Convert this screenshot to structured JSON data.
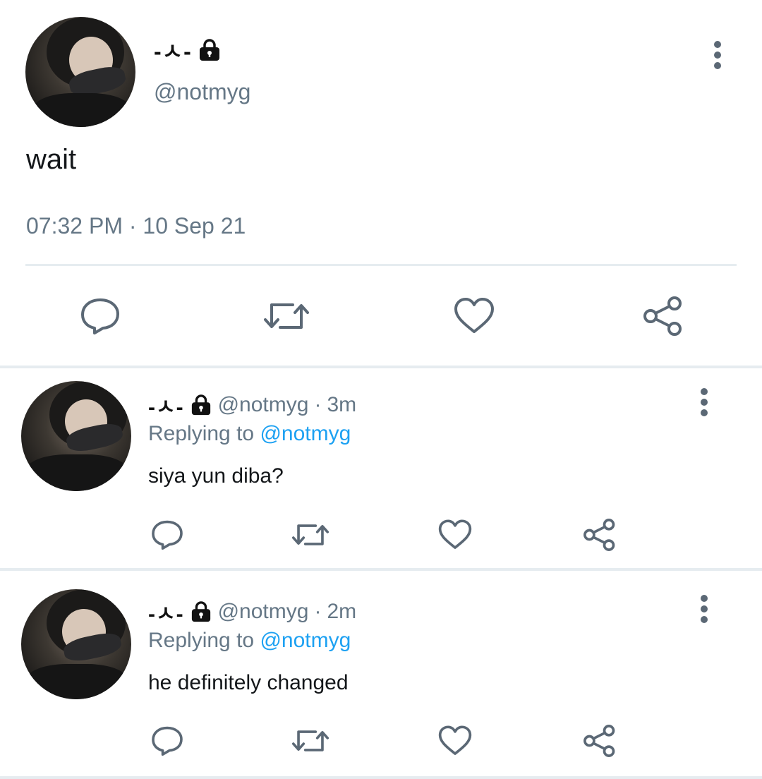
{
  "main_tweet": {
    "display_name": "-ㅅ-",
    "handle": "@notmyg",
    "text": "wait",
    "time": "07:32 PM",
    "separator": "·",
    "date": "10 Sep 21"
  },
  "replies": [
    {
      "display_name": "-ㅅ-",
      "handle": "@notmyg",
      "separator": "·",
      "age": "3m",
      "replying_prefix": "Replying to",
      "replying_to": "@notmyg",
      "text": "siya yun diba?"
    },
    {
      "display_name": "-ㅅ-",
      "handle": "@notmyg",
      "separator": "·",
      "age": "2m",
      "replying_prefix": "Replying to",
      "replying_to": "@notmyg",
      "text": "he definitely changed"
    }
  ],
  "icons": {
    "lock": "lock-icon",
    "more": "more-vertical-icon",
    "reply": "reply-icon",
    "retweet": "retweet-icon",
    "like": "heart-icon",
    "share": "share-icon"
  },
  "colors": {
    "secondary_text": "#657786",
    "mention": "#1da1f2",
    "icon": "#5b6875",
    "divider": "#e6ecf0"
  }
}
